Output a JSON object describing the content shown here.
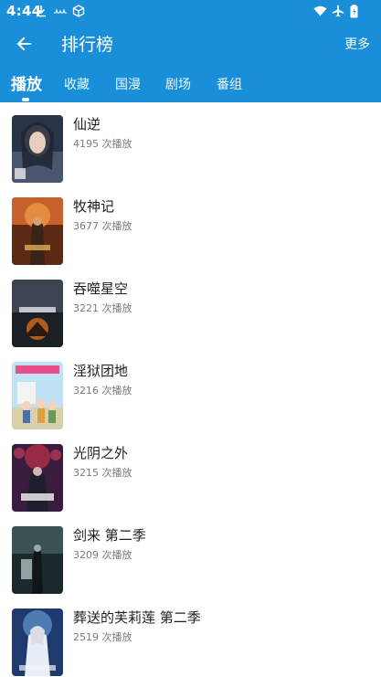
{
  "status_bar": {
    "time": "4:44",
    "icons": [
      "download-icon",
      "notification-icon",
      "cube-icon",
      "wifi-icon",
      "airplane-mode-icon",
      "battery-icon"
    ]
  },
  "toolbar": {
    "back_icon": "arrow-left-icon",
    "title": "排行榜",
    "more_label": "更多"
  },
  "tabs": [
    {
      "label": "播放",
      "active": true
    },
    {
      "label": "收藏",
      "active": false
    },
    {
      "label": "国漫",
      "active": false
    },
    {
      "label": "剧场",
      "active": false
    },
    {
      "label": "番组",
      "active": false
    }
  ],
  "rankings": [
    {
      "title": "仙逆",
      "plays": "4195 次播放"
    },
    {
      "title": "牧神记",
      "plays": "3677 次播放"
    },
    {
      "title": "吞噬星空",
      "plays": "3221 次播放"
    },
    {
      "title": "淫狱团地",
      "plays": "3216 次播放"
    },
    {
      "title": "光阴之外",
      "plays": "3215 次播放"
    },
    {
      "title": "剑来 第二季",
      "plays": "3209 次播放"
    },
    {
      "title": "葬送的芙莉莲 第二季",
      "plays": "2519 次播放"
    }
  ],
  "colors": {
    "app_bar": "#1a8fd9",
    "title_text": "#1f1f1f",
    "meta_text": "#7a7a7a"
  }
}
